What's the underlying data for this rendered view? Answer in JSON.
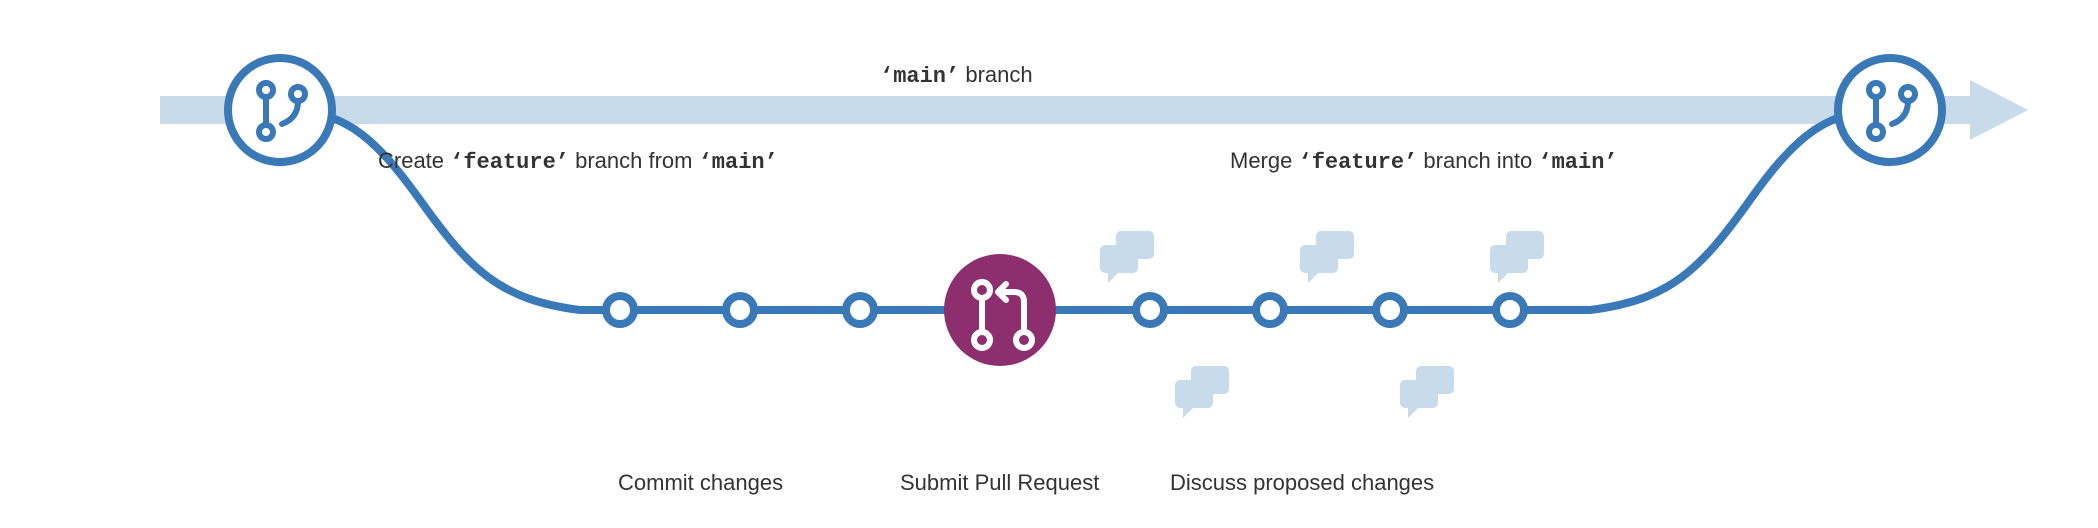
{
  "colors": {
    "main_branch_arrow": "#c7dbea",
    "flow_line": "#3a79b7",
    "node_fill": "#ffffff",
    "pr_circle": "#8d2f6f",
    "chat_bubble": "#c7dbea",
    "text": "#333333"
  },
  "branch_label": {
    "quote_open": "‘",
    "name": "main",
    "quote_close": "’",
    "suffix": " branch"
  },
  "create_label": {
    "prefix": "Create ",
    "q1o": "‘",
    "feature": "feature",
    "q1c": "’",
    "middle": " branch from ",
    "q2o": "‘",
    "main": "main",
    "q2c": "’"
  },
  "merge_label": {
    "prefix": "Merge ",
    "q1o": "‘",
    "feature": "feature",
    "q1c": "’",
    "middle": " branch into ",
    "q2o": "‘",
    "main": "main",
    "q2c": "’"
  },
  "steps": {
    "commit": "Commit changes",
    "pr": "Submit Pull Request",
    "discuss": "Discuss proposed changes"
  },
  "icons": {
    "git_branch": "git-branch-icon",
    "pull_request": "pull-request-icon",
    "chat": "chat-icon"
  }
}
